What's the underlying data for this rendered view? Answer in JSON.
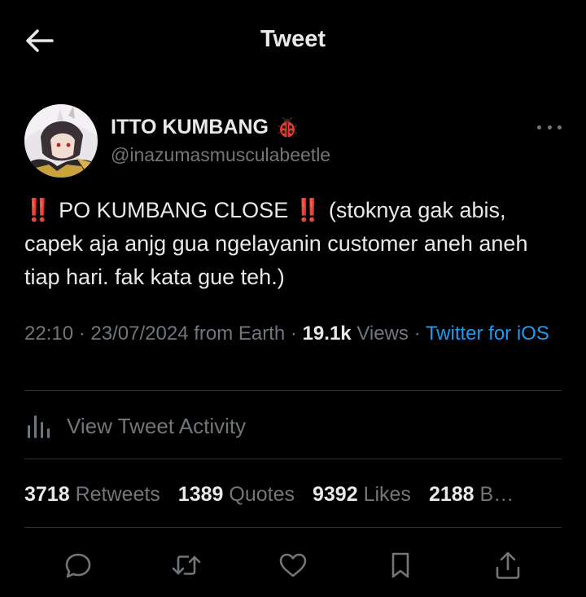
{
  "header": {
    "title": "Tweet",
    "back_icon": "arrow-left-icon"
  },
  "author": {
    "display_name": "ITTO KUMBANG",
    "name_emoji": "ladybug-icon",
    "handle": "@inazumasmusculabeetle"
  },
  "tweet": {
    "bang_1": "‼️",
    "part_1": "PO KUMBANG CLOSE",
    "bang_2": "‼️",
    "part_2": "(stoknya gak abis, capek aja anjg gua ngelayanin customer aneh aneh tiap hari. fak kata gue teh.)"
  },
  "meta": {
    "time": "22:10",
    "sep_1": "·",
    "date": "23/07/2024",
    "location": "from Earth",
    "sep_2": "·",
    "views_count": "19.1k",
    "views_label": "Views",
    "sep_3": "·",
    "client": "Twitter for iOS"
  },
  "activity": {
    "label": "View Tweet Activity"
  },
  "stats": {
    "retweets_count": "3718",
    "retweets_label": "Retweets",
    "quotes_count": "1389",
    "quotes_label": "Quotes",
    "likes_count": "9392",
    "likes_label": "Likes",
    "bookmarks_count": "2188",
    "bookmarks_label": "B…"
  },
  "colors": {
    "background": "#000000",
    "text_primary": "#e7e9ea",
    "text_secondary": "#71767b",
    "link": "#1d9bf0",
    "divider": "#2f3336",
    "emphasis_red": "#e0262c"
  }
}
